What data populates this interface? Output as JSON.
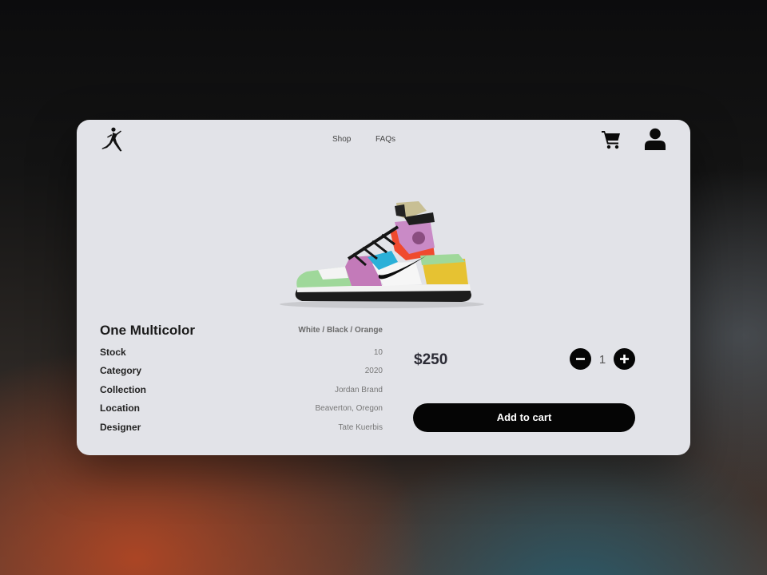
{
  "header": {
    "logo_icon": "jumpman-logo-icon",
    "nav": [
      {
        "label": "Shop"
      },
      {
        "label": "FAQs"
      }
    ],
    "cart_icon": "shopping-cart-icon",
    "user_icon": "user-profile-icon"
  },
  "product": {
    "image_icon": "sneaker-image",
    "name": "One Multicolor",
    "colorway": "White / Black / Orange",
    "specs": [
      {
        "label": "Stock",
        "value": "10"
      },
      {
        "label": "Category",
        "value": "2020"
      },
      {
        "label": "Collection",
        "value": "Jordan Brand"
      },
      {
        "label": "Location",
        "value": "Beaverton, Oregon"
      },
      {
        "label": "Designer",
        "value": "Tate Kuerbis"
      }
    ],
    "price": "$250",
    "quantity": "1",
    "add_to_cart_label": "Add to cart"
  },
  "colors": {
    "card_background": "#e2e3e8",
    "button_background": "#050505",
    "button_text": "#ffffff"
  }
}
